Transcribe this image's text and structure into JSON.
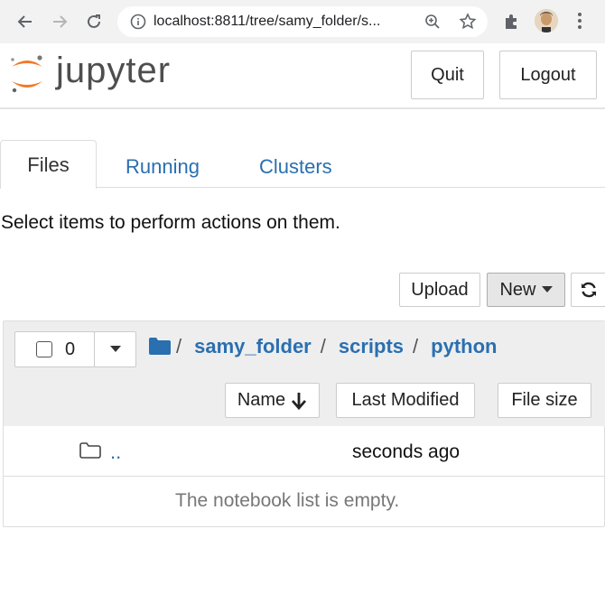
{
  "browser": {
    "url": "localhost:8811/tree/samy_folder/s..."
  },
  "header": {
    "logo_text": "jupyter",
    "quit_label": "Quit",
    "logout_label": "Logout"
  },
  "tabs": [
    {
      "label": "Files"
    },
    {
      "label": "Running"
    },
    {
      "label": "Clusters"
    }
  ],
  "message": "Select items to perform actions on them.",
  "toolbar": {
    "upload_label": "Upload",
    "new_label": "New"
  },
  "list": {
    "selected_count": "0",
    "breadcrumb": [
      "samy_folder",
      "scripts",
      "python"
    ],
    "breadcrumb_sep": "/",
    "columns": {
      "name": "Name",
      "last_modified": "Last Modified",
      "file_size": "File size"
    },
    "parent_row": {
      "name": "..",
      "modified": "seconds ago"
    },
    "empty_message": "The notebook list is empty."
  },
  "colors": {
    "link": "#2a6fb0",
    "logo_orange": "#f37726"
  }
}
